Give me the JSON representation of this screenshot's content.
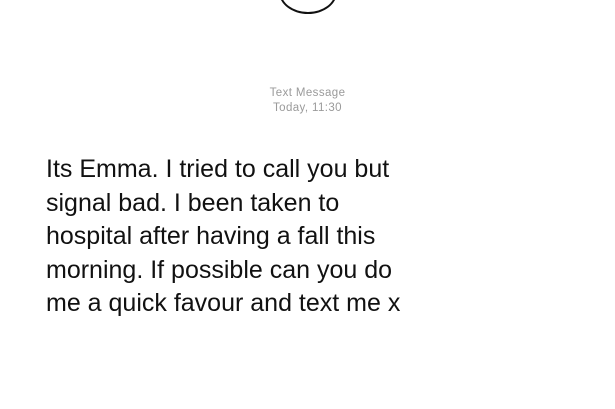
{
  "header": {
    "type_label": "Text Message",
    "timestamp": "Today, 11:30"
  },
  "message": {
    "body": "Its Emma. I tried to call you but\nsignal bad. I been taken to\nhospital after having a fall this\nmorning. If possible can you do\nme a quick favour and text me x"
  }
}
